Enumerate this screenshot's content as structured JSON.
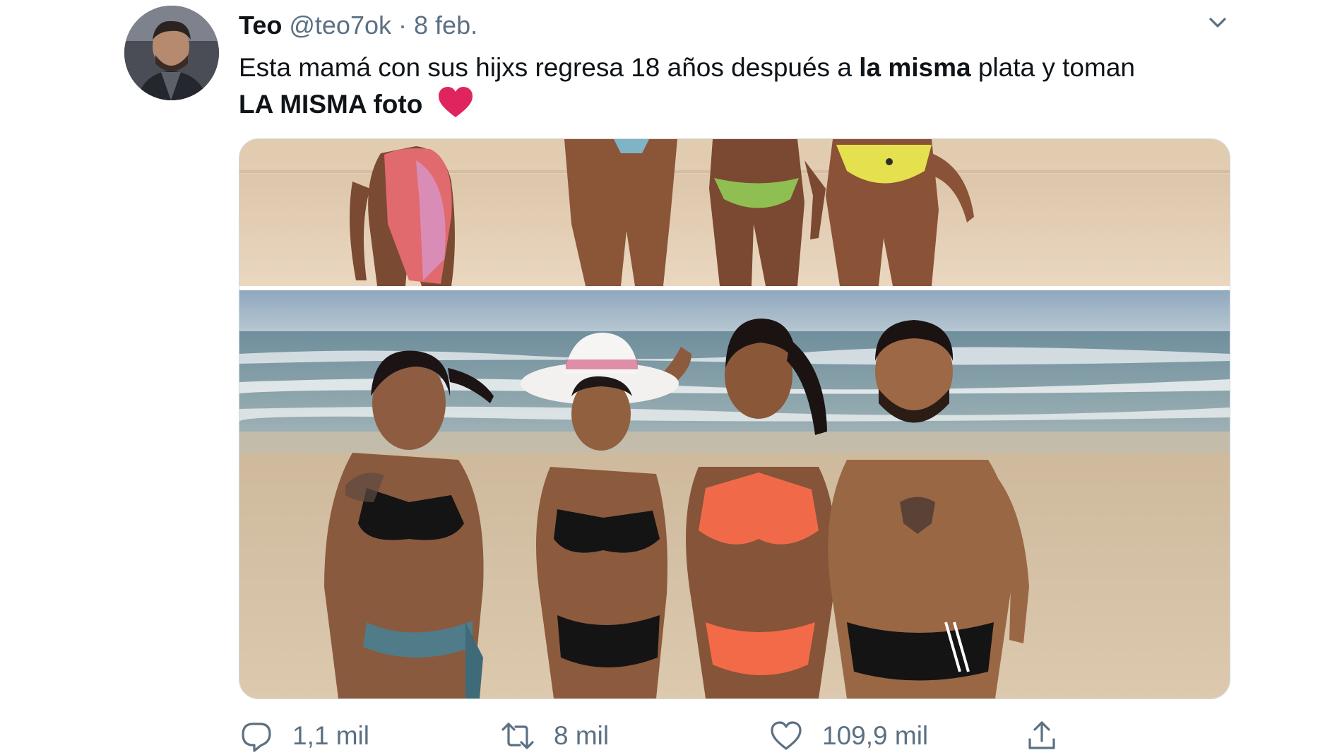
{
  "tweet": {
    "author_name": "Teo",
    "handle": "@teo7ok",
    "separator": "·",
    "date": "8 feb.",
    "text_part1": "Esta mamá con sus hijxs regresa 18 años después a ",
    "text_bold1": "la misma",
    "text_part2": " plata y toman",
    "text_bold2": "LA MISMA foto",
    "emoji": "red-heart-emoji"
  },
  "actions": {
    "reply_count": "1,1 mil",
    "retweet_count": "8 mil",
    "like_count": "109,9 mil"
  },
  "icons": {
    "caret": "chevron-down-icon",
    "reply": "reply-icon",
    "retweet": "retweet-icon",
    "like": "heart-icon",
    "share": "share-icon"
  },
  "colors": {
    "text_primary": "#0f1419",
    "text_secondary": "#5b7083",
    "heart_red": "#e0245e",
    "border": "#cfd9de"
  }
}
